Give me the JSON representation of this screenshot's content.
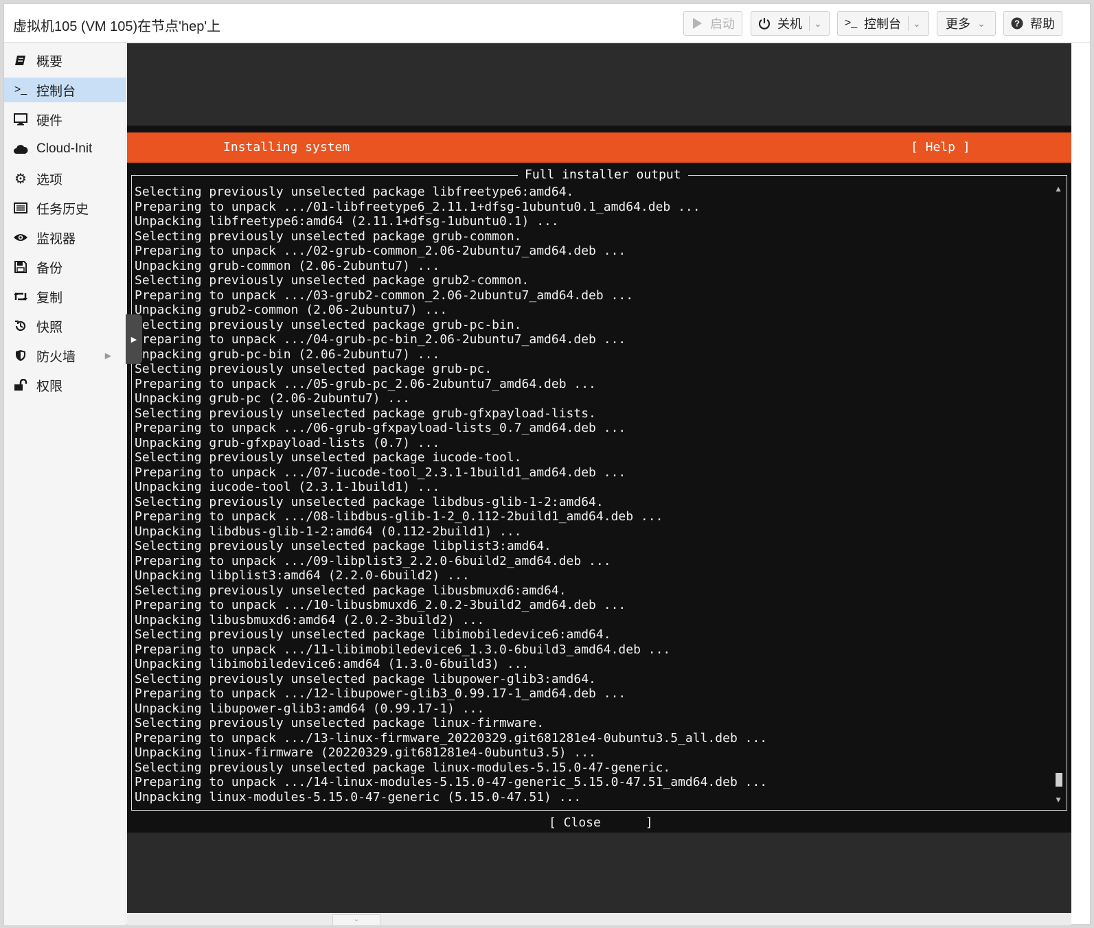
{
  "titlebar": {
    "title": "虚拟机105 (VM 105)在节点'hep'上",
    "start_label": "启动",
    "shutdown_label": "关机",
    "console_label": "控制台",
    "more_label": "更多",
    "help_label": "帮助"
  },
  "sidebar": {
    "items": [
      {
        "label": "概要",
        "icon": "book-icon"
      },
      {
        "label": "控制台",
        "icon": "terminal-icon"
      },
      {
        "label": "硬件",
        "icon": "monitor-icon"
      },
      {
        "label": "Cloud-Init",
        "icon": "cloud-icon"
      },
      {
        "label": "选项",
        "icon": "gear-icon"
      },
      {
        "label": "任务历史",
        "icon": "list-icon"
      },
      {
        "label": "监视器",
        "icon": "eye-icon"
      },
      {
        "label": "备份",
        "icon": "floppy-icon"
      },
      {
        "label": "复制",
        "icon": "retweet-icon"
      },
      {
        "label": "快照",
        "icon": "history-icon"
      },
      {
        "label": "防火墙",
        "icon": "shield-icon"
      },
      {
        "label": "权限",
        "icon": "unlock-icon"
      }
    ],
    "active_index": 1
  },
  "console": {
    "header_left": "Installing system",
    "header_right": "[ Help ]",
    "frame_title": "Full installer output",
    "close_label": "[ Close      ]",
    "accent_color": "#e95420",
    "lines": [
      "Selecting previously unselected package libfreetype6:amd64.",
      "Preparing to unpack .../01-libfreetype6_2.11.1+dfsg-1ubuntu0.1_amd64.deb ...",
      "Unpacking libfreetype6:amd64 (2.11.1+dfsg-1ubuntu0.1) ...",
      "Selecting previously unselected package grub-common.",
      "Preparing to unpack .../02-grub-common_2.06-2ubuntu7_amd64.deb ...",
      "Unpacking grub-common (2.06-2ubuntu7) ...",
      "Selecting previously unselected package grub2-common.",
      "Preparing to unpack .../03-grub2-common_2.06-2ubuntu7_amd64.deb ...",
      "Unpacking grub2-common (2.06-2ubuntu7) ...",
      "Selecting previously unselected package grub-pc-bin.",
      "Preparing to unpack .../04-grub-pc-bin_2.06-2ubuntu7_amd64.deb ...",
      "Unpacking grub-pc-bin (2.06-2ubuntu7) ...",
      "Selecting previously unselected package grub-pc.",
      "Preparing to unpack .../05-grub-pc_2.06-2ubuntu7_amd64.deb ...",
      "Unpacking grub-pc (2.06-2ubuntu7) ...",
      "Selecting previously unselected package grub-gfxpayload-lists.",
      "Preparing to unpack .../06-grub-gfxpayload-lists_0.7_amd64.deb ...",
      "Unpacking grub-gfxpayload-lists (0.7) ...",
      "Selecting previously unselected package iucode-tool.",
      "Preparing to unpack .../07-iucode-tool_2.3.1-1build1_amd64.deb ...",
      "Unpacking iucode-tool (2.3.1-1build1) ...",
      "Selecting previously unselected package libdbus-glib-1-2:amd64.",
      "Preparing to unpack .../08-libdbus-glib-1-2_0.112-2build1_amd64.deb ...",
      "Unpacking libdbus-glib-1-2:amd64 (0.112-2build1) ...",
      "Selecting previously unselected package libplist3:amd64.",
      "Preparing to unpack .../09-libplist3_2.2.0-6build2_amd64.deb ...",
      "Unpacking libplist3:amd64 (2.2.0-6build2) ...",
      "Selecting previously unselected package libusbmuxd6:amd64.",
      "Preparing to unpack .../10-libusbmuxd6_2.0.2-3build2_amd64.deb ...",
      "Unpacking libusbmuxd6:amd64 (2.0.2-3build2) ...",
      "Selecting previously unselected package libimobiledevice6:amd64.",
      "Preparing to unpack .../11-libimobiledevice6_1.3.0-6build3_amd64.deb ...",
      "Unpacking libimobiledevice6:amd64 (1.3.0-6build3) ...",
      "Selecting previously unselected package libupower-glib3:amd64.",
      "Preparing to unpack .../12-libupower-glib3_0.99.17-1_amd64.deb ...",
      "Unpacking libupower-glib3:amd64 (0.99.17-1) ...",
      "Selecting previously unselected package linux-firmware.",
      "Preparing to unpack .../13-linux-firmware_20220329.git681281e4-0ubuntu3.5_all.deb ...",
      "Unpacking linux-firmware (20220329.git681281e4-0ubuntu3.5) ...",
      "Selecting previously unselected package linux-modules-5.15.0-47-generic.",
      "Preparing to unpack .../14-linux-modules-5.15.0-47-generic_5.15.0-47.51_amd64.deb ...",
      "Unpacking linux-modules-5.15.0-47-generic (5.15.0-47.51) ..."
    ]
  }
}
